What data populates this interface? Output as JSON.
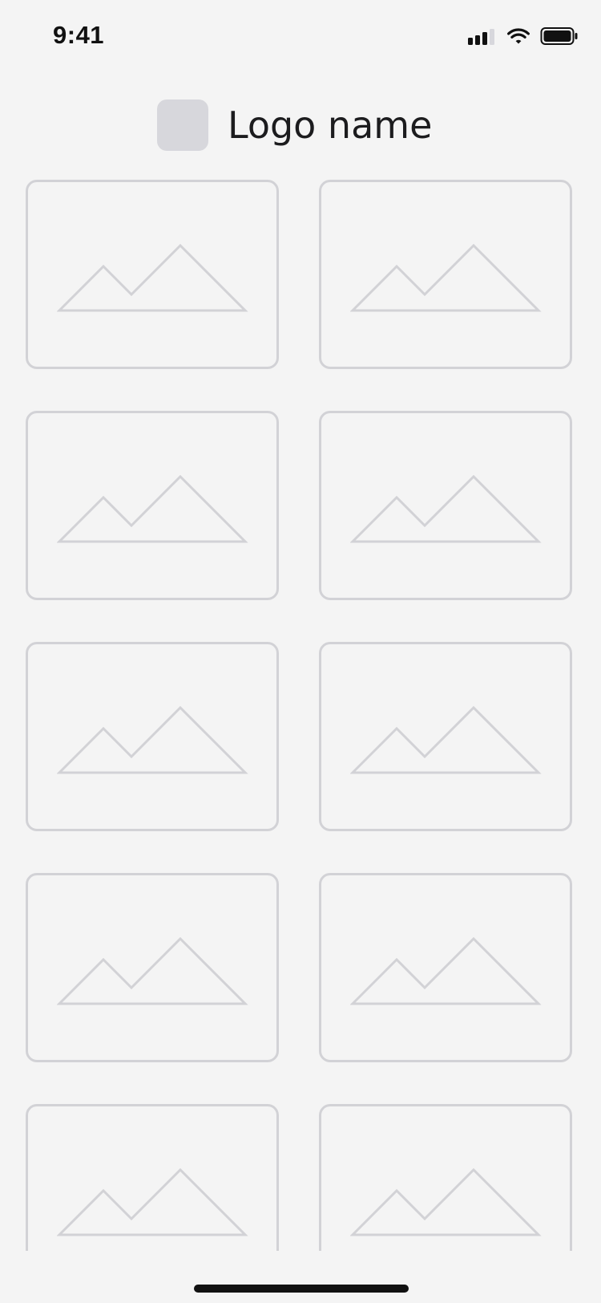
{
  "status_bar": {
    "time": "9:41",
    "icons": [
      "signal-bars-icon",
      "wifi-icon",
      "battery-icon"
    ]
  },
  "header": {
    "logo_name": "Logo name",
    "logo_icon": "logo-placeholder-icon"
  },
  "grid": {
    "items": [
      {
        "icon": "image-placeholder-icon"
      },
      {
        "icon": "image-placeholder-icon"
      },
      {
        "icon": "image-placeholder-icon"
      },
      {
        "icon": "image-placeholder-icon"
      },
      {
        "icon": "image-placeholder-icon"
      },
      {
        "icon": "image-placeholder-icon"
      },
      {
        "icon": "image-placeholder-icon"
      },
      {
        "icon": "image-placeholder-icon"
      },
      {
        "icon": "image-placeholder-icon"
      },
      {
        "icon": "image-placeholder-icon"
      }
    ]
  },
  "colors": {
    "background": "#f4f4f4",
    "placeholder_stroke": "#d2d2d6",
    "logo_box": "#d7d7dc",
    "text": "#1c1c1e"
  }
}
